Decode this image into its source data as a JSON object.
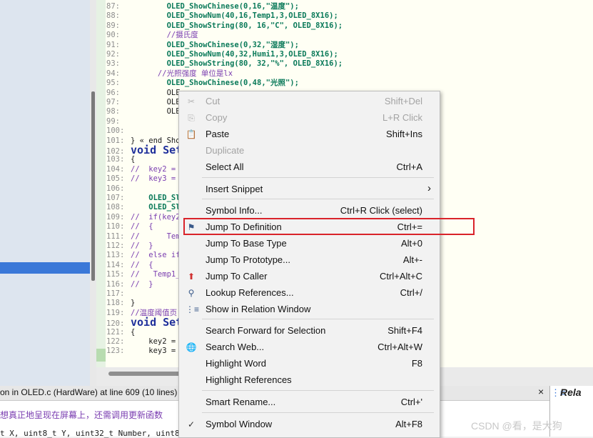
{
  "code_lines": [
    {
      "ln": "87:",
      "text": "        OLED_ShowChinese(0,16,\"温度\");"
    },
    {
      "ln": "88:",
      "text": "        OLED_ShowNum(40,16,Temp1,3,OLED_8X16);"
    },
    {
      "ln": "89:",
      "text": "        OLED_ShowString(80, 16,\"C\", OLED_8X16);"
    },
    {
      "ln": "90:",
      "text": "        //摄氏度"
    },
    {
      "ln": "91:",
      "text": "        OLED_ShowChinese(0,32,\"湿度\");"
    },
    {
      "ln": "92:",
      "text": "        OLED_ShowNum(40,32,Humi1,3,OLED_8X16);"
    },
    {
      "ln": "93:",
      "text": "        OLED_ShowString(80, 32,\"%\", OLED_8X16);"
    },
    {
      "ln": "94:",
      "text": "      //光照强度 单位是lx"
    },
    {
      "ln": "95:",
      "text": "        OLED_ShowChinese(0,48,\"光照\");"
    },
    {
      "ln": "96:",
      "text": "        OLE"
    },
    {
      "ln": "97:",
      "text": "        OLE"
    },
    {
      "ln": "98:",
      "text": "        OLE"
    },
    {
      "ln": "99:",
      "text": ""
    },
    {
      "ln": "100:",
      "text": ""
    },
    {
      "ln": "101:",
      "text": "} « end ShowM"
    },
    {
      "ln": "102:",
      "text": "void SetD"
    },
    {
      "ln": "103:",
      "text": "{"
    },
    {
      "ln": "104:",
      "text": "//  key2 ="
    },
    {
      "ln": "105:",
      "text": "//  key3 ="
    },
    {
      "ln": "106:",
      "text": ""
    },
    {
      "ln": "107:",
      "text": "    OLED_Sl"
    },
    {
      "ln": "108:",
      "text": "    OLED_Sl"
    },
    {
      "ln": "109:",
      "text": "//  if(key2"
    },
    {
      "ln": "110:",
      "text": "//  {"
    },
    {
      "ln": "111:",
      "text": "//      Tem"
    },
    {
      "ln": "112:",
      "text": "//  }"
    },
    {
      "ln": "113:",
      "text": "//  else if"
    },
    {
      "ln": "114:",
      "text": "//  {"
    },
    {
      "ln": "115:",
      "text": "//   Temp1_"
    },
    {
      "ln": "116:",
      "text": "//  }"
    },
    {
      "ln": "117:",
      "text": ""
    },
    {
      "ln": "118:",
      "text": "}"
    },
    {
      "ln": "119:",
      "text": "//温度阈值页"
    },
    {
      "ln": "120:",
      "text": "void SetD"
    },
    {
      "ln": "121:",
      "text": "{"
    },
    {
      "ln": "122:",
      "text": "    key2 ="
    },
    {
      "ln": "123:",
      "text": "    key3 ="
    }
  ],
  "find_panel": {
    "title": "on in OLED.c (HardWare) at line 609 (10 lines)",
    "close_label": "×",
    "line1": "想真正地呈现在屏幕上，还需调用更新函数",
    "line2": "t X, uint8_t Y, uint32_t Number, uint8_t"
  },
  "relation_panel": {
    "title": "Rela",
    "icon": "relation-window-icon"
  },
  "watermark": "CSDN @看，是大狗",
  "context_menu": {
    "items": [
      {
        "label": "Cut",
        "shortcut": "Shift+Del",
        "disabled": true,
        "icon": "scissors-icon"
      },
      {
        "label": "Copy",
        "shortcut": "L+R Click",
        "disabled": true,
        "icon": "copy-icon"
      },
      {
        "label": "Paste",
        "shortcut": "Shift+Ins",
        "disabled": false,
        "icon": "paste-icon"
      },
      {
        "label": "Duplicate",
        "shortcut": "",
        "disabled": true,
        "icon": ""
      },
      {
        "label": "Select All",
        "shortcut": "Ctrl+A",
        "disabled": false,
        "icon": ""
      },
      {
        "label": "Insert Snippet",
        "shortcut": "›",
        "disabled": false,
        "icon": ""
      },
      {
        "label": "Symbol Info...",
        "shortcut": "Ctrl+R Click (select)",
        "disabled": false,
        "icon": ""
      },
      {
        "label": "Jump To Definition",
        "shortcut": "Ctrl+=",
        "disabled": false,
        "icon": "jump-definition-icon"
      },
      {
        "label": "Jump To Base Type",
        "shortcut": "Alt+0",
        "disabled": false,
        "icon": ""
      },
      {
        "label": "Jump To Prototype...",
        "shortcut": "Alt+-",
        "disabled": false,
        "icon": ""
      },
      {
        "label": "Jump To Caller",
        "shortcut": "Ctrl+Alt+C",
        "disabled": false,
        "icon": "jump-caller-icon"
      },
      {
        "label": "Lookup References...",
        "shortcut": "Ctrl+/",
        "disabled": false,
        "icon": "lookup-references-icon"
      },
      {
        "label": "Show in Relation Window",
        "shortcut": "",
        "disabled": false,
        "icon": "relation-window-icon"
      },
      {
        "label": "Search Forward for Selection",
        "shortcut": "Shift+F4",
        "disabled": false,
        "icon": ""
      },
      {
        "label": "Search Web...",
        "shortcut": "Ctrl+Alt+W",
        "disabled": false,
        "icon": "search-web-icon"
      },
      {
        "label": "Highlight Word",
        "shortcut": "F8",
        "disabled": false,
        "icon": ""
      },
      {
        "label": "Highlight References",
        "shortcut": "",
        "disabled": false,
        "icon": ""
      },
      {
        "label": "Smart Rename...",
        "shortcut": "Ctrl+'",
        "disabled": false,
        "icon": ""
      },
      {
        "label": "Symbol Window",
        "shortcut": "Alt+F8",
        "disabled": false,
        "icon": "checkmark-icon"
      }
    ]
  },
  "colors": {
    "highlight_box": "#d9232a",
    "selection_blue": "#3a78d8"
  }
}
